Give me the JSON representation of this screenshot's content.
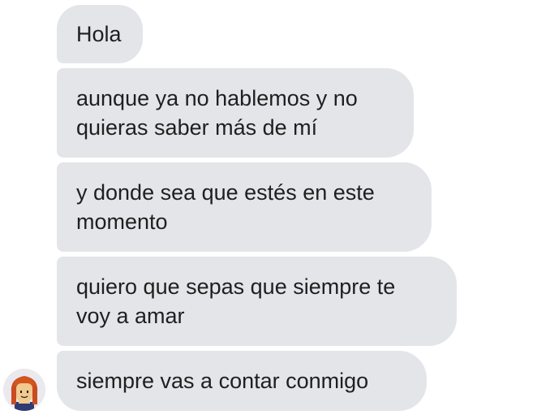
{
  "conversation": {
    "messages": [
      {
        "text": "Hola"
      },
      {
        "text": "aunque ya no hablemos y no\nquieras saber más de mí"
      },
      {
        "text": "y donde sea que estés en este\nmomento"
      },
      {
        "text": "quiero que sepas que siempre te\nvoy a amar"
      },
      {
        "text": "siempre vas a contar conmigo"
      }
    ],
    "sender_avatar": {
      "icon": "roblox-avatar-icon",
      "hair_color": "#c94b1f",
      "skin_color": "#f2c98f",
      "shirt_color": "#303a73"
    },
    "bubble_color": "#e4e5e9",
    "text_color": "#1f1f1f"
  }
}
